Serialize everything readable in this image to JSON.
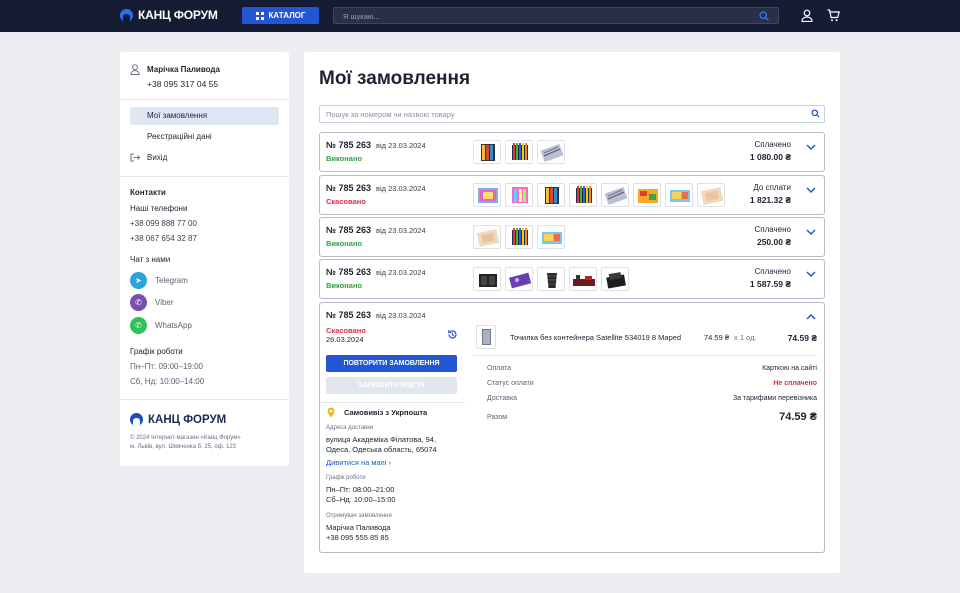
{
  "header": {
    "logo": "КАНЦ ФОРУМ",
    "catalog": "КАТАЛОГ",
    "search_placeholder": "Я шукаю..."
  },
  "sidebar": {
    "user_name": "Марічка Паливода",
    "user_phone": "+38 095 317 04 55",
    "menu": [
      {
        "label": "Мої замовлення",
        "active": true
      },
      {
        "label": "Реєстраційні дані"
      },
      {
        "label": "Вихід"
      }
    ],
    "contacts_title": "Контакти",
    "phones_title": "Наші телефони",
    "phones": [
      "+38 099 888 77 00",
      "+38 067 654 32 87"
    ],
    "chat_title": "Чат з нами",
    "messengers": [
      {
        "name": "Telegram",
        "color": "#2aa3df"
      },
      {
        "name": "Viber",
        "color": "#7b4fb0"
      },
      {
        "name": "WhatsApp",
        "color": "#2fc15a"
      }
    ],
    "schedule_title": "Графік роботи",
    "schedule": [
      "Пн–Пт: 09:00–19:00",
      "Сб, Нд: 10:00–14:00"
    ],
    "footer_logo": "КАНЦ ФОРУМ",
    "copyright": [
      "© 2024 Інтернет-магазин «Канц Форум»",
      "м. Львів, вул. Шевченка б. 25, оф. 123"
    ]
  },
  "main": {
    "title": "Мої замовлення",
    "search_placeholder": "Пошук за номером чи назвою товару",
    "orders": [
      {
        "num": "№ 785 263",
        "date": "від 23.03.2024",
        "status": "Виконано",
        "status_type": "done",
        "pay_label": "Сплачено",
        "amount": "1 080.00 ₴",
        "thumbs": [
          "pencils",
          "markers",
          "pens"
        ]
      },
      {
        "num": "№ 785 263",
        "date": "від 23.03.2024",
        "status": "Скасовано",
        "status_type": "cancel",
        "pay_label": "До сплати",
        "amount": "1 821.32 ₴",
        "thumbs": [
          "paper",
          "markers-pink",
          "pencils",
          "markers",
          "pens",
          "stickers",
          "cards",
          "paper-beige"
        ]
      },
      {
        "num": "№ 785 263",
        "date": "від 23.03.2024",
        "status": "Виконано",
        "status_type": "done",
        "pay_label": "Сплачено",
        "amount": "250.00 ₴",
        "thumbs": [
          "paper-beige",
          "markers",
          "cards"
        ]
      },
      {
        "num": "№ 785 263",
        "date": "від 23.03.2024",
        "status": "Виконано",
        "status_type": "done",
        "pay_label": "Сплачено",
        "amount": "1 587.59 ₴",
        "thumbs": [
          "desk-box",
          "purple-tray",
          "bin",
          "desk-set",
          "organizer"
        ]
      }
    ],
    "expanded": {
      "num": "№ 785 263",
      "date": "від 23.03.2024",
      "status": "Скасовано",
      "status_date": "26.03.2024",
      "repeat_btn": "ПОВТОРИТИ ЗАМОВЛЕННЯ",
      "review_btn": "ЗАЛИШИТИ ВІДГУК",
      "delivery_title": "Самовивіз з Укрпошта",
      "address_label": "Адреса доставки",
      "address": [
        "вулиця Академіка Філатова, 94,",
        "Одеса, Одеська область, 65074"
      ],
      "map_link": "Дивитися на мапі",
      "hours_label": "Графік роботи",
      "hours": [
        "Пн–Пт: 08:00–21:00",
        "Сб–Нд: 10:00–15:00"
      ],
      "recipient_label": "Отримувач замовлення",
      "recipient": [
        "Марічка Паливода",
        "+38 095 555 85 85"
      ],
      "item": {
        "name": "Точилка без контейнера Satellite 534019 8 Maped",
        "price": "74.59 ₴",
        "qty": "x 1 од.",
        "total": "74.59 ₴"
      },
      "payment_label": "Оплата",
      "payment_value": "Карткою на сайті",
      "pay_status_label": "Статус оплати",
      "pay_status_value": "Не сплачено",
      "delivery_label": "Доставка",
      "delivery_value": "За тарифами перевізника",
      "sum_label": "Разом",
      "sum_value": "74.59 ₴"
    }
  },
  "colors": {
    "accent": "#2356d3",
    "header_bg": "#151c33",
    "done": "#2ea043",
    "cancel": "#d6304a"
  }
}
